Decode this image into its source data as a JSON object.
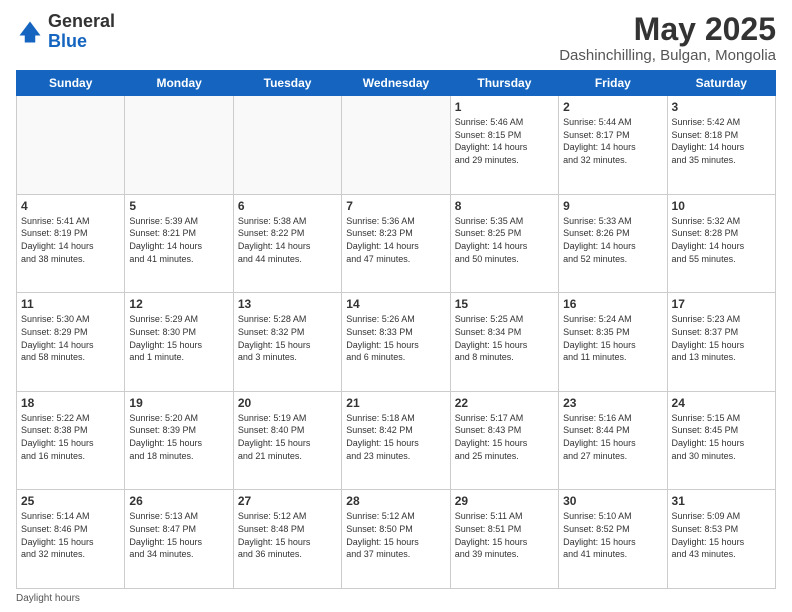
{
  "header": {
    "logo_general": "General",
    "logo_blue": "Blue",
    "month_year": "May 2025",
    "location": "Dashinchilling, Bulgan, Mongolia"
  },
  "footer": {
    "label": "Daylight hours"
  },
  "days_of_week": [
    "Sunday",
    "Monday",
    "Tuesday",
    "Wednesday",
    "Thursday",
    "Friday",
    "Saturday"
  ],
  "weeks": [
    [
      {
        "num": "",
        "info": ""
      },
      {
        "num": "",
        "info": ""
      },
      {
        "num": "",
        "info": ""
      },
      {
        "num": "",
        "info": ""
      },
      {
        "num": "1",
        "info": "Sunrise: 5:46 AM\nSunset: 8:15 PM\nDaylight: 14 hours\nand 29 minutes."
      },
      {
        "num": "2",
        "info": "Sunrise: 5:44 AM\nSunset: 8:17 PM\nDaylight: 14 hours\nand 32 minutes."
      },
      {
        "num": "3",
        "info": "Sunrise: 5:42 AM\nSunset: 8:18 PM\nDaylight: 14 hours\nand 35 minutes."
      }
    ],
    [
      {
        "num": "4",
        "info": "Sunrise: 5:41 AM\nSunset: 8:19 PM\nDaylight: 14 hours\nand 38 minutes."
      },
      {
        "num": "5",
        "info": "Sunrise: 5:39 AM\nSunset: 8:21 PM\nDaylight: 14 hours\nand 41 minutes."
      },
      {
        "num": "6",
        "info": "Sunrise: 5:38 AM\nSunset: 8:22 PM\nDaylight: 14 hours\nand 44 minutes."
      },
      {
        "num": "7",
        "info": "Sunrise: 5:36 AM\nSunset: 8:23 PM\nDaylight: 14 hours\nand 47 minutes."
      },
      {
        "num": "8",
        "info": "Sunrise: 5:35 AM\nSunset: 8:25 PM\nDaylight: 14 hours\nand 50 minutes."
      },
      {
        "num": "9",
        "info": "Sunrise: 5:33 AM\nSunset: 8:26 PM\nDaylight: 14 hours\nand 52 minutes."
      },
      {
        "num": "10",
        "info": "Sunrise: 5:32 AM\nSunset: 8:28 PM\nDaylight: 14 hours\nand 55 minutes."
      }
    ],
    [
      {
        "num": "11",
        "info": "Sunrise: 5:30 AM\nSunset: 8:29 PM\nDaylight: 14 hours\nand 58 minutes."
      },
      {
        "num": "12",
        "info": "Sunrise: 5:29 AM\nSunset: 8:30 PM\nDaylight: 15 hours\nand 1 minute."
      },
      {
        "num": "13",
        "info": "Sunrise: 5:28 AM\nSunset: 8:32 PM\nDaylight: 15 hours\nand 3 minutes."
      },
      {
        "num": "14",
        "info": "Sunrise: 5:26 AM\nSunset: 8:33 PM\nDaylight: 15 hours\nand 6 minutes."
      },
      {
        "num": "15",
        "info": "Sunrise: 5:25 AM\nSunset: 8:34 PM\nDaylight: 15 hours\nand 8 minutes."
      },
      {
        "num": "16",
        "info": "Sunrise: 5:24 AM\nSunset: 8:35 PM\nDaylight: 15 hours\nand 11 minutes."
      },
      {
        "num": "17",
        "info": "Sunrise: 5:23 AM\nSunset: 8:37 PM\nDaylight: 15 hours\nand 13 minutes."
      }
    ],
    [
      {
        "num": "18",
        "info": "Sunrise: 5:22 AM\nSunset: 8:38 PM\nDaylight: 15 hours\nand 16 minutes."
      },
      {
        "num": "19",
        "info": "Sunrise: 5:20 AM\nSunset: 8:39 PM\nDaylight: 15 hours\nand 18 minutes."
      },
      {
        "num": "20",
        "info": "Sunrise: 5:19 AM\nSunset: 8:40 PM\nDaylight: 15 hours\nand 21 minutes."
      },
      {
        "num": "21",
        "info": "Sunrise: 5:18 AM\nSunset: 8:42 PM\nDaylight: 15 hours\nand 23 minutes."
      },
      {
        "num": "22",
        "info": "Sunrise: 5:17 AM\nSunset: 8:43 PM\nDaylight: 15 hours\nand 25 minutes."
      },
      {
        "num": "23",
        "info": "Sunrise: 5:16 AM\nSunset: 8:44 PM\nDaylight: 15 hours\nand 27 minutes."
      },
      {
        "num": "24",
        "info": "Sunrise: 5:15 AM\nSunset: 8:45 PM\nDaylight: 15 hours\nand 30 minutes."
      }
    ],
    [
      {
        "num": "25",
        "info": "Sunrise: 5:14 AM\nSunset: 8:46 PM\nDaylight: 15 hours\nand 32 minutes."
      },
      {
        "num": "26",
        "info": "Sunrise: 5:13 AM\nSunset: 8:47 PM\nDaylight: 15 hours\nand 34 minutes."
      },
      {
        "num": "27",
        "info": "Sunrise: 5:12 AM\nSunset: 8:48 PM\nDaylight: 15 hours\nand 36 minutes."
      },
      {
        "num": "28",
        "info": "Sunrise: 5:12 AM\nSunset: 8:50 PM\nDaylight: 15 hours\nand 37 minutes."
      },
      {
        "num": "29",
        "info": "Sunrise: 5:11 AM\nSunset: 8:51 PM\nDaylight: 15 hours\nand 39 minutes."
      },
      {
        "num": "30",
        "info": "Sunrise: 5:10 AM\nSunset: 8:52 PM\nDaylight: 15 hours\nand 41 minutes."
      },
      {
        "num": "31",
        "info": "Sunrise: 5:09 AM\nSunset: 8:53 PM\nDaylight: 15 hours\nand 43 minutes."
      }
    ]
  ]
}
